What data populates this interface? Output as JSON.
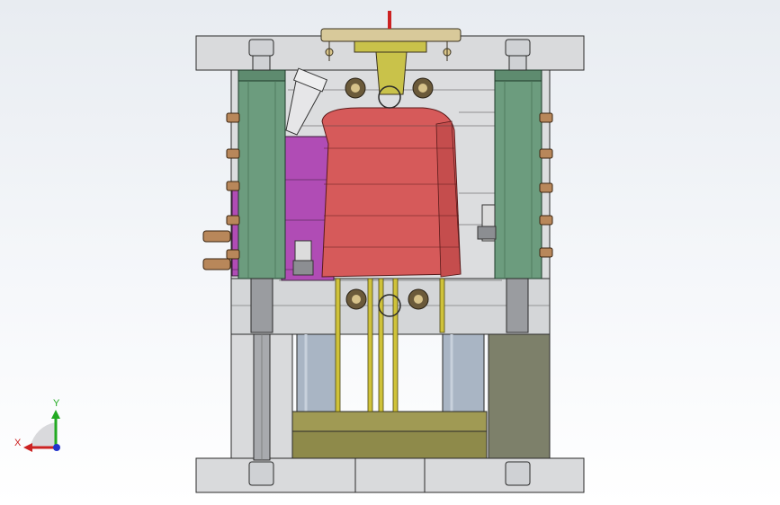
{
  "view": {
    "background_top": "#e8ecf1",
    "background_bottom": "#ffffff",
    "edge_color": "#2a2a2a"
  },
  "colors": {
    "plate": "#d9dadc",
    "plate_dark": "#c5c7ca",
    "guide_pillar": "#6c9c7e",
    "core": "#d65a5a",
    "cavity_insert": "#b04cb5",
    "sprue": "#c9c24a",
    "ejector_pin": "#cfc23a",
    "support_pillar": "#a9b5c4",
    "ejector_plate": "#8e8a4a",
    "block": "#7d806a",
    "cooling_fitting": "#b8875a"
  },
  "triad": {
    "x_label": "X",
    "y_label": "Y",
    "x_color": "#cc2222",
    "y_color": "#22aa22",
    "z_color": "#2233cc"
  }
}
